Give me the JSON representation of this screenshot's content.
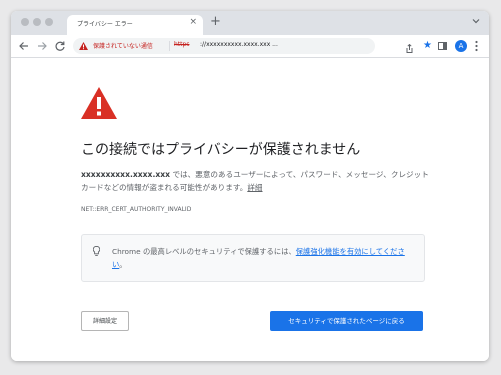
{
  "tab": {
    "title": "プライバシー エラー",
    "close_glyph": "×"
  },
  "toolbar": {
    "not_secure_label": "保護されていない通信",
    "url_scheme": "https",
    "url_rest": "://xxxxxxxxxx.xxxx.xxx ...",
    "avatar_letter": "A"
  },
  "page": {
    "heading": "この接続ではプライバシーが保護されません",
    "desc_host": "xxxxxxxxxx.xxxx.xxx",
    "desc_text": " では、悪意のあるユーザーによって、パスワード、メッセージ、クレジット カードなどの情報が盗まれる可能性があります。",
    "details_link": "詳細",
    "error_code": "NET::ERR_CERT_AUTHORITY_INVALID",
    "safe_browsing_prefix": "Chrome の最高レベルのセキュリティで保護するには、",
    "safe_browsing_link": "保護強化機能を有効にしてください",
    "safe_browsing_suffix": "。",
    "advanced_button": "詳細設定",
    "back_button": "セキュリティで保護されたページに戻る"
  },
  "colors": {
    "accent": "#1a73e8",
    "danger": "#c5221f",
    "warning_icon": "#d93025"
  },
  "icons": [
    "warning-icon",
    "close-icon",
    "plus-icon",
    "chevron-down-icon",
    "back-icon",
    "forward-icon",
    "reload-icon",
    "share-icon",
    "star-icon",
    "side-panel-icon",
    "kebab-menu-icon",
    "lightbulb-icon"
  ]
}
